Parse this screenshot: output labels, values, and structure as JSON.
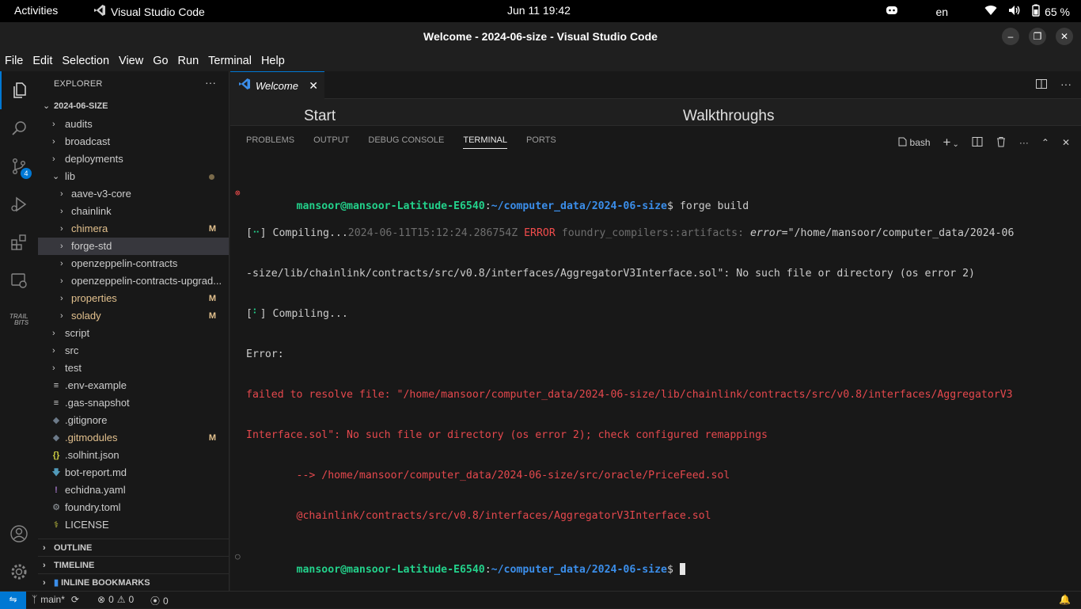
{
  "topbar": {
    "activities": "Activities",
    "app_name": "Visual Studio Code",
    "clock": "Jun 11  19:42",
    "language": "en",
    "battery": "65 %"
  },
  "window": {
    "title": "Welcome - 2024-06-size - Visual Studio Code"
  },
  "menu": [
    "File",
    "Edit",
    "Selection",
    "View",
    "Go",
    "Run",
    "Terminal",
    "Help"
  ],
  "activity_bar": {
    "scm_badge": "4"
  },
  "explorer": {
    "title": "EXPLORER",
    "more": "···",
    "root": "2024-06-SIZE",
    "items": [
      {
        "label": "audits"
      },
      {
        "label": "broadcast"
      },
      {
        "label": "deployments"
      },
      {
        "label": "lib"
      },
      {
        "label": "aave-v3-core"
      },
      {
        "label": "chainlink"
      },
      {
        "label": "chimera",
        "flag": "M"
      },
      {
        "label": "forge-std"
      },
      {
        "label": "openzeppelin-contracts"
      },
      {
        "label": "openzeppelin-contracts-upgrad..."
      },
      {
        "label": "properties",
        "flag": "M"
      },
      {
        "label": "solady",
        "flag": "M"
      },
      {
        "label": "script"
      },
      {
        "label": "src"
      },
      {
        "label": "test"
      },
      {
        "label": ".env-example"
      },
      {
        "label": ".gas-snapshot"
      },
      {
        "label": ".gitignore"
      },
      {
        "label": ".gitmodules",
        "flag": "M"
      },
      {
        "label": ".solhint.json"
      },
      {
        "label": "bot-report.md"
      },
      {
        "label": "echidna.yaml"
      },
      {
        "label": "foundry.toml"
      },
      {
        "label": "LICENSE"
      }
    ],
    "sections": [
      "OUTLINE",
      "TIMELINE",
      "INLINE BOOKMARKS"
    ]
  },
  "editor": {
    "tab_label": "Welcome",
    "welcome_start": "Start",
    "welcome_walkthroughs": "Walkthroughs"
  },
  "panel": {
    "tabs": [
      "PROBLEMS",
      "OUTPUT",
      "DEBUG CONSOLE",
      "TERMINAL",
      "PORTS"
    ],
    "shell": "bash"
  },
  "terminal": {
    "prompt_user": "mansoor@mansoor-Latitude-E6540",
    "prompt_path": "~/computer_data/2024-06-size",
    "command": "forge build",
    "l2_a": "[",
    "l2_spin": "⠒",
    "l2_b": "] Compiling...",
    "l2_ts": "2024-06-11T15:12:24.286754Z",
    "l2_level": "ERROR",
    "l2_target": "foundry_compilers::artifacts:",
    "l2_key": "error",
    "l2_msg": "=\"/home/mansoor/computer_data/2024-06",
    "l3": "-size/lib/chainlink/contracts/src/v0.8/interfaces/AggregatorV3Interface.sol\": No such file or directory (os error 2)",
    "l4_a": "[",
    "l4_spin": "⠃",
    "l4_b": "] Compiling...",
    "l5": "Error:",
    "l6": "failed to resolve file: \"/home/mansoor/computer_data/2024-06-size/lib/chainlink/contracts/src/v0.8/interfaces/AggregatorV3",
    "l7": "Interface.sol\": No such file or directory (os error 2); check configured remappings",
    "l8": "        --> /home/mansoor/computer_data/2024-06-size/src/oracle/PriceFeed.sol",
    "l9": "        @chainlink/contracts/src/v0.8/interfaces/AggregatorV3Interface.sol"
  },
  "statusbar": {
    "branch": "main*",
    "errors": "0",
    "warnings": "0",
    "ports": "0"
  }
}
